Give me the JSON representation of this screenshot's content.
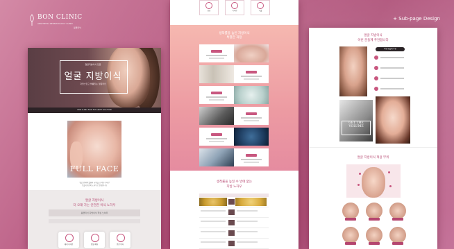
{
  "brand": {
    "name": "BON CLINIC",
    "tagline": "AESTHETIC DERMATOLOGY CLINIC",
    "tagline_sub": "봉클리닉"
  },
  "header": {
    "subpage_label": "+ Sub-page Design"
  },
  "panel1": {
    "hero_subtitle": "얼굴지방이식 전문",
    "hero_title": "얼굴 지방이식",
    "hero_small": "자연스럽고 볼륨있는 얼굴라인",
    "strip_text": "BON CLINIC FACE FAT GRAFT SOLUTION",
    "fullface_label": "FULL FACE",
    "caption_1": "얼굴 전체의 볼륨과 균형을 고려한 디자인",
    "caption_2": "봉클리닉만의 노하우로 완성합니다",
    "heading_1": "얼굴 지방이식",
    "heading_2": "더 오래 가는 안전한 이식 노하우",
    "band_text": "봉클리닉 지방이식 핵심 노하우",
    "cards": [
      "체계 디자인",
      "정밀 채취",
      "안전 이식"
    ]
  },
  "panel2": {
    "top_boxes": [
      "상담",
      "디자인",
      "시술"
    ],
    "heading_1": "생착률을 높인 지방이식",
    "heading_2": "특별한 과정",
    "lower_heading_1": "생착률을 높일 수 밖에 없는",
    "lower_heading_2": "지방 노하우"
  },
  "panel3": {
    "heading_1": "얼굴 지방이식",
    "heading_2": "이런 분들께 추천합니다",
    "checklist_header": "이런 분들께 추천",
    "volume_text": "GET THE VOLUME",
    "heading_3": "얼굴 지방이식 적용 부위"
  },
  "colors": {
    "background": "#b85a82",
    "accent": "#c8577f",
    "heading_pink": "#b5466f",
    "dark": "#2c2226"
  }
}
